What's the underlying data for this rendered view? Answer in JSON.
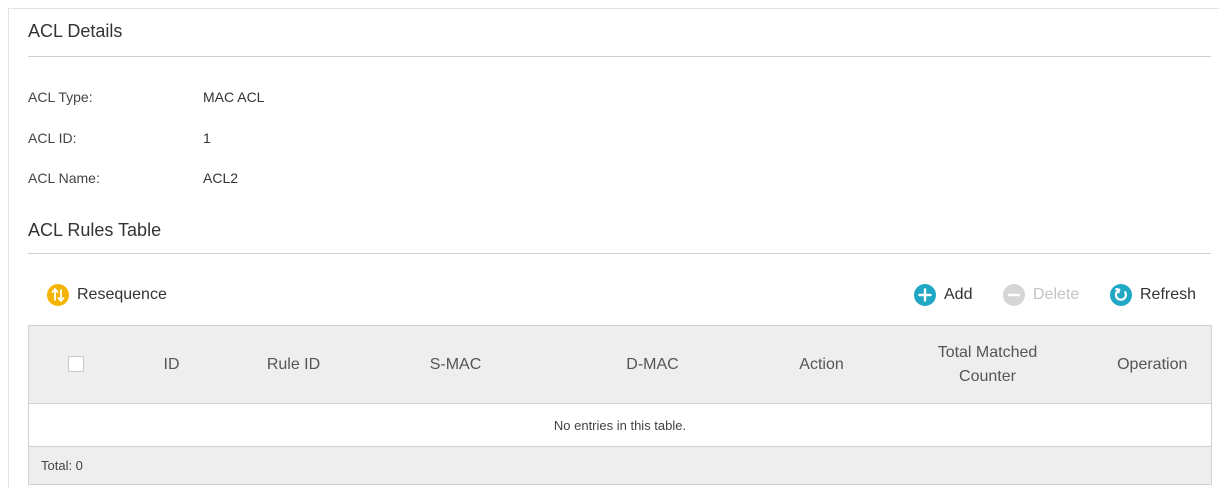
{
  "details": {
    "title": "ACL Details",
    "fields": [
      {
        "label": "ACL Type:",
        "value": "MAC ACL"
      },
      {
        "label": "ACL ID:",
        "value": "1"
      },
      {
        "label": "ACL Name:",
        "value": "ACL2"
      }
    ]
  },
  "rules": {
    "title": "ACL Rules Table",
    "toolbar": {
      "resequence": "Resequence",
      "add": "Add",
      "delete": "Delete",
      "refresh": "Refresh"
    },
    "columns": [
      "ID",
      "Rule ID",
      "S-MAC",
      "D-MAC",
      "Action",
      "Total Matched Counter",
      "Operation"
    ],
    "empty_message": "No entries in this table.",
    "total_text": "Total: 0"
  },
  "colors": {
    "resequence_icon": "#f5b400",
    "accent_icon": "#1fa7c4",
    "disabled_icon": "#d6d6d6"
  },
  "icons": {
    "resequence": "resequence-icon",
    "add": "plus-circle-icon",
    "delete": "minus-circle-icon",
    "refresh": "refresh-icon"
  }
}
